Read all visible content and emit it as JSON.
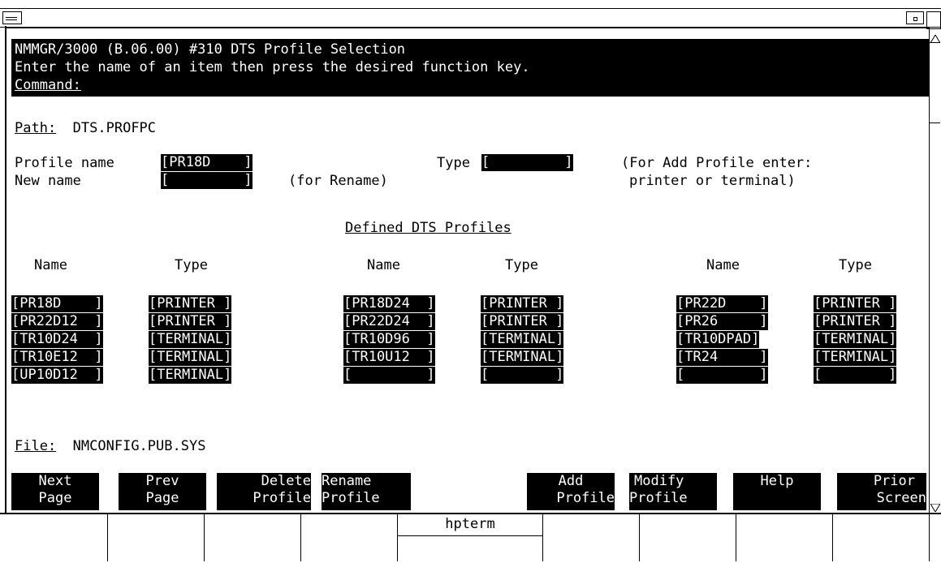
{
  "window": {
    "title": "hpterm"
  },
  "header": {
    "line1": "NMMGR/3000 (B.06.00) #310 DTS Profile Selection",
    "line2": "Enter the name of an item then press the desired function key.",
    "command_label": "Command:"
  },
  "path": {
    "label": "Path:",
    "value": "DTS.PROFPC"
  },
  "form": {
    "profile_name_label": "Profile name",
    "profile_name_value": "[PR18D    ]",
    "new_name_label": "New name",
    "new_name_value": "[         ]",
    "rename_hint": "(for Rename)",
    "type_label": "Type",
    "type_value": "[         ]",
    "add_hint_1": "(For Add Profile enter:",
    "add_hint_2": "printer or terminal)"
  },
  "section_title": "Defined DTS Profiles",
  "columns": {
    "name": "Name",
    "type": "Type"
  },
  "profiles": [
    [
      {
        "name": "[PR18D    ]",
        "type": "[PRINTER ]"
      },
      {
        "name": "[PR22D12  ]",
        "type": "[PRINTER ]"
      },
      {
        "name": "[TR10D24  ]",
        "type": "[TERMINAL]"
      },
      {
        "name": "[TR10E12  ]",
        "type": "[TERMINAL]"
      },
      {
        "name": "[UP10D12  ]",
        "type": "[TERMINAL]"
      }
    ],
    [
      {
        "name": "[PR18D24  ]",
        "type": "[PRINTER ]"
      },
      {
        "name": "[PR22D24  ]",
        "type": "[PRINTER ]"
      },
      {
        "name": "[TR10D96  ]",
        "type": "[TERMINAL]"
      },
      {
        "name": "[TR10U12  ]",
        "type": "[TERMINAL]"
      },
      {
        "name": "[         ]",
        "type": "[        ]"
      }
    ],
    [
      {
        "name": "[PR22D    ]",
        "type": "[PRINTER ]"
      },
      {
        "name": "[PR26     ]",
        "type": "[PRINTER ]"
      },
      {
        "name": "[TR10DPAD]",
        "type": "[TERMINAL]"
      },
      {
        "name": "[TR24     ]",
        "type": "[TERMINAL]"
      },
      {
        "name": "[         ]",
        "type": "[        ]"
      }
    ]
  ],
  "file": {
    "label": "File:",
    "value": "NMCONFIG.PUB.SYS"
  },
  "function_keys": [
    {
      "l1": "Next",
      "l2": "Page"
    },
    {
      "l1": "Prev",
      "l2": "Page"
    },
    {
      "l1": "Delete",
      "l2": "Profile"
    },
    {
      "l1": "Rename",
      "l2": "Profile"
    },
    {
      "l1": "",
      "l2": ""
    },
    {
      "l1": "Add",
      "l2": "Profile"
    },
    {
      "l1": "Modify",
      "l2": "Profile"
    },
    {
      "l1": "Help",
      "l2": ""
    },
    {
      "l1": "Prior",
      "l2": "Screen"
    }
  ],
  "colors": {
    "background": "#ffffff",
    "foreground": "#000000"
  }
}
